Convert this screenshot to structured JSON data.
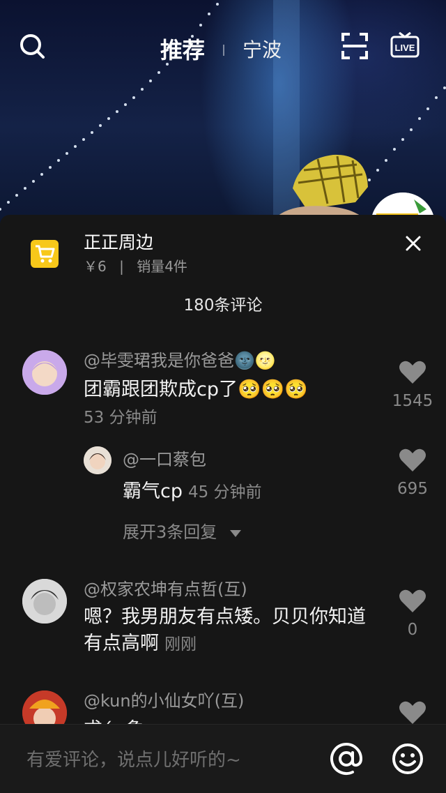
{
  "header": {
    "tabs": [
      {
        "label": "推荐",
        "active": true
      },
      {
        "label": "宁波",
        "active": false
      }
    ],
    "icons": [
      "search-icon",
      "scan-icon",
      "live-icon"
    ]
  },
  "product": {
    "title": "正正周边",
    "price": "￥6",
    "separator": "|",
    "sales": "销量4件",
    "icon": "shopping-cart-icon"
  },
  "comments_header": {
    "count_label": "180条评论"
  },
  "comments": [
    {
      "user": "@毕雯珺我是你爸爸🌚🌝",
      "text": "团霸跟团欺成cp了🥺🥺🥺",
      "time": "53 分钟前",
      "likes": "1545",
      "reply": {
        "user": "@一口蔡包",
        "text": "霸气cp",
        "time": "45 分钟前",
        "likes": "695"
      },
      "expand_label": "展开3条回复"
    },
    {
      "user": "@权家农坤有点哲(互)",
      "text": "嗯？我男朋友有点矮。贝贝你知道有点高啊",
      "time": "刚刚",
      "likes": "0"
    },
    {
      "user": "@kun的小仙女吖(互)",
      "text": "求án象",
      "time": "",
      "likes": ""
    }
  ],
  "composer": {
    "placeholder": "有爱评论，说点儿好听的~",
    "icons": [
      "at-icon",
      "emoji-icon"
    ]
  },
  "colors": {
    "sheet_bg": "#161616",
    "accent": "#f7c81a",
    "text_muted": "#9a9a9a"
  }
}
